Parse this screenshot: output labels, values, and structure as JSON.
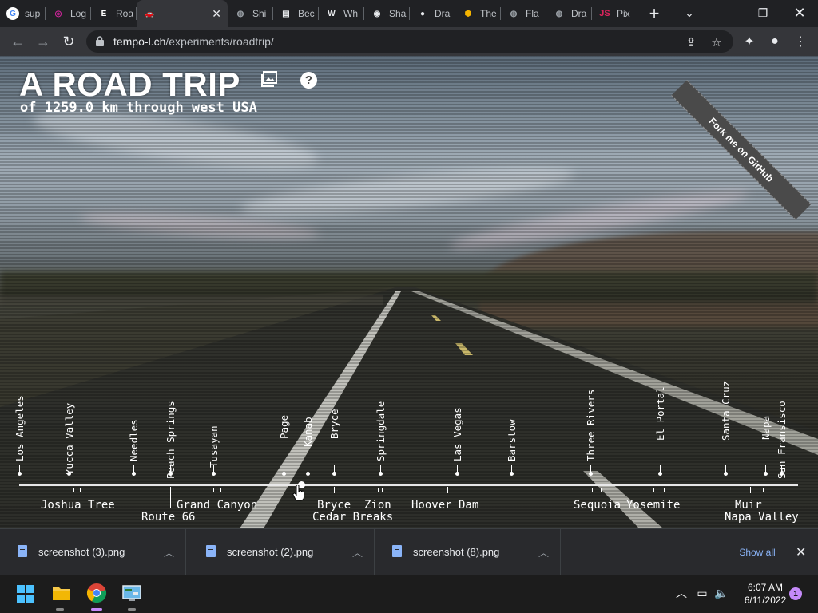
{
  "browser": {
    "tabs": [
      {
        "label": "sup",
        "icon": "google-icon",
        "color": "#4285f4",
        "glyph": "G"
      },
      {
        "label": "Log",
        "icon": "instagram-icon",
        "color": "#d6249f",
        "glyph": "◎"
      },
      {
        "label": "Roa",
        "icon": "e-icon",
        "color": "#ffffff",
        "glyph": "E"
      },
      {
        "label": "",
        "icon": "car-icon",
        "color": "#9aa0a6",
        "glyph": "🚗",
        "active": true
      },
      {
        "label": "Shi",
        "icon": "globe-icon",
        "color": "#9aa0a6",
        "glyph": "◍"
      },
      {
        "label": "Bec",
        "icon": "page-icon",
        "color": "#e8eaed",
        "glyph": "▤"
      },
      {
        "label": "Wh",
        "icon": "w-icon",
        "color": "#e8eaed",
        "glyph": "W"
      },
      {
        "label": "Sha",
        "icon": "circle-logo-icon",
        "color": "#e8eaed",
        "glyph": "◉"
      },
      {
        "label": "Dra",
        "icon": "github-icon",
        "color": "#e8eaed",
        "glyph": "●"
      },
      {
        "label": "The",
        "icon": "hexagon-icon",
        "color": "#f5b400",
        "glyph": "⬢"
      },
      {
        "label": "Fla",
        "icon": "globe-icon",
        "color": "#9aa0a6",
        "glyph": "◍"
      },
      {
        "label": "Dra",
        "icon": "globe-icon",
        "color": "#9aa0a6",
        "glyph": "◍"
      },
      {
        "label": "Pix",
        "icon": "js-icon",
        "color": "#f0db4f",
        "glyph": "JS"
      }
    ],
    "url_host": "tempo-l.ch",
    "url_path": "/experiments/roadtrip/"
  },
  "page": {
    "title": "A ROAD TRIP",
    "subtitle": "of 1259.0 km through west USA",
    "help_glyph": "?",
    "ribbon_text": "Fork me on GitHub"
  },
  "timeline": {
    "stops": [
      {
        "label": "Los Angeles"
      },
      {
        "label": "Yucca Valley"
      },
      {
        "label": "Needles"
      },
      {
        "label": "Peach Springs"
      },
      {
        "label": "Tusayan"
      },
      {
        "label": "Page"
      },
      {
        "label": "Kanab"
      },
      {
        "label": "Bryce"
      },
      {
        "label": "Springdale"
      },
      {
        "label": "Las Vegas"
      },
      {
        "label": "Barstow"
      },
      {
        "label": "Three Rivers"
      },
      {
        "label": "El Portal"
      },
      {
        "label": "Santa Cruz"
      },
      {
        "label": "Napa"
      },
      {
        "label": "San Fransisco"
      }
    ],
    "regions": [
      {
        "label": "Joshua Tree"
      },
      {
        "label": "Route 66"
      },
      {
        "label": "Grand Canyon"
      },
      {
        "label": "Bryce"
      },
      {
        "label": "Zion"
      },
      {
        "label": "Cedar Breaks"
      },
      {
        "label": "Hoover Dam"
      },
      {
        "label": "Sequoia"
      },
      {
        "label": "Yosemite"
      },
      {
        "label": "Muir"
      },
      {
        "label": "Napa Valley"
      }
    ]
  },
  "downloads": {
    "items": [
      {
        "name": "screenshot (3).png"
      },
      {
        "name": "screenshot (2).png"
      },
      {
        "name": "screenshot (8).png"
      }
    ],
    "show_all": "Show all"
  },
  "taskbar": {
    "time": "6:07 AM",
    "date": "6/11/2022",
    "notification_count": "1"
  }
}
